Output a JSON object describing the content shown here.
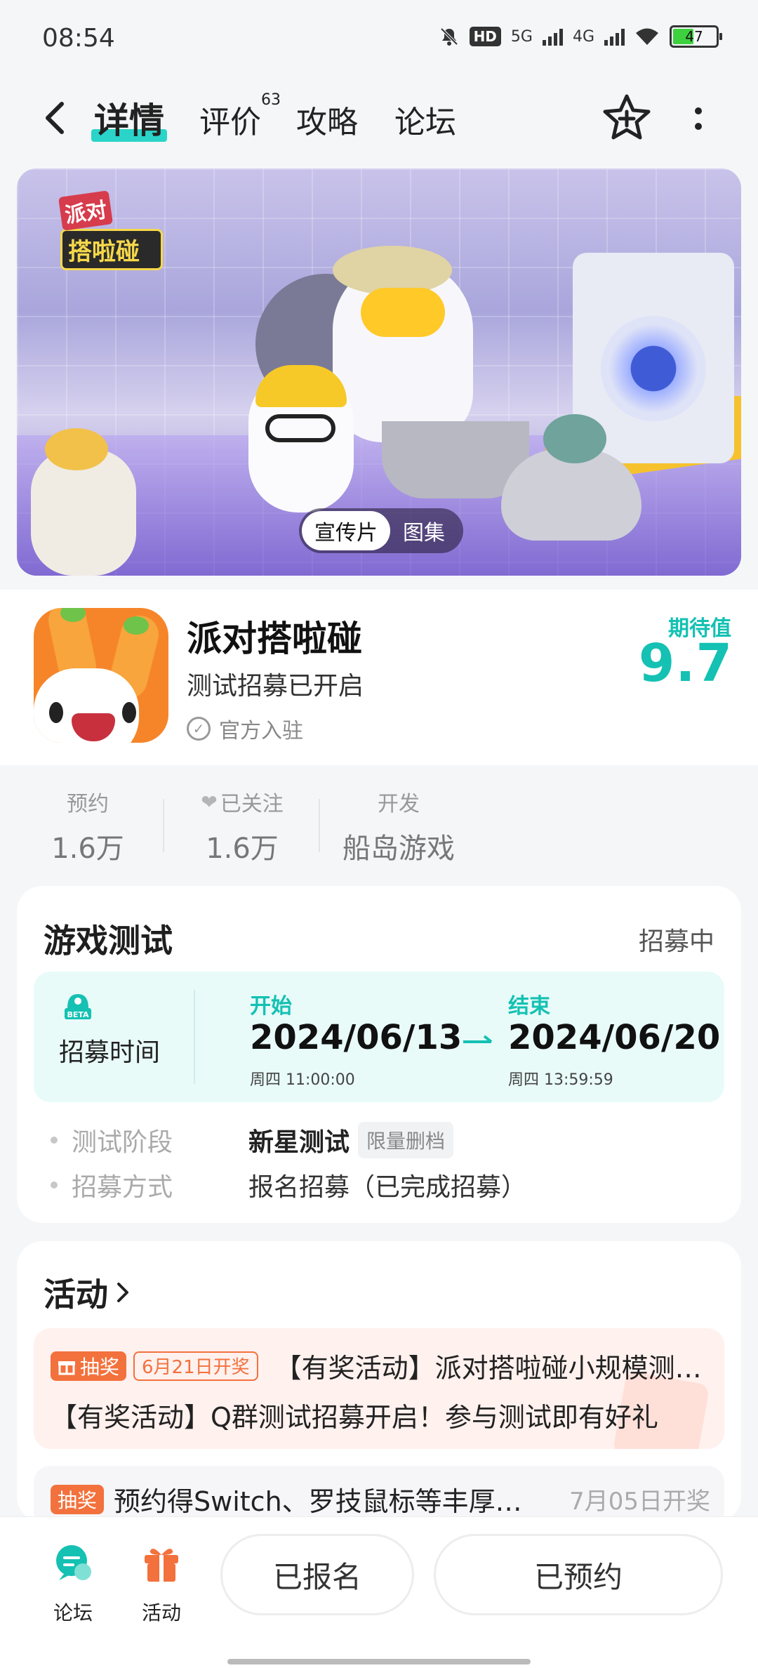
{
  "status_bar": {
    "time": "08:54",
    "hd": "HD",
    "net1": "5G",
    "net2": "4G",
    "battery": "47"
  },
  "nav": {
    "tabs": [
      {
        "label": "详情"
      },
      {
        "label": "评价",
        "count": "63"
      },
      {
        "label": "攻略"
      },
      {
        "label": "论坛"
      }
    ]
  },
  "hero": {
    "logo_top": "派对",
    "logo_bottom": "搭啦碰",
    "media_options": [
      "宣传片",
      "图集"
    ]
  },
  "app": {
    "name": "派对搭啦碰",
    "subtitle": "测试招募已开启",
    "official": "官方入驻",
    "score_label": "期待值",
    "score": "9.7"
  },
  "stats": [
    {
      "label": "预约",
      "value": "1.6万"
    },
    {
      "label": "已关注",
      "value": "1.6万"
    },
    {
      "label": "开发",
      "value": "船岛游戏"
    }
  ],
  "test": {
    "title": "游戏测试",
    "status": "招募中",
    "period_label": "招募时间",
    "beta": "BETA",
    "start_label": "开始",
    "start_date": "2024/06/13",
    "start_time": "周四  11:00:00",
    "end_label": "结束",
    "end_date": "2024/06/20",
    "end_time": "周四  13:59:59",
    "rows": [
      {
        "key": "测试阶段",
        "value": "新星测试",
        "tag": "限量删档"
      },
      {
        "key": "招募方式",
        "value": "报名招募（已完成招募）"
      }
    ]
  },
  "activity": {
    "title": "活动",
    "items": [
      {
        "tag": "抽奖",
        "date_tag": "6月21日开奖",
        "title": "【有奖活动】派对搭啦碰小规模测试招募",
        "desc": "【有奖活动】Q群测试招募开启！参与测试即有好礼"
      },
      {
        "tag": "抽奖",
        "title": "预约得Switch、罗技鼠标等丰厚好礼",
        "date": "7月05日开奖"
      }
    ]
  },
  "bottom": {
    "forum": "论坛",
    "events": "活动",
    "registered": "已报名",
    "reserved": "已预约"
  },
  "colors": {
    "accent": "#14c1b3",
    "lottery": "#f3713c"
  }
}
